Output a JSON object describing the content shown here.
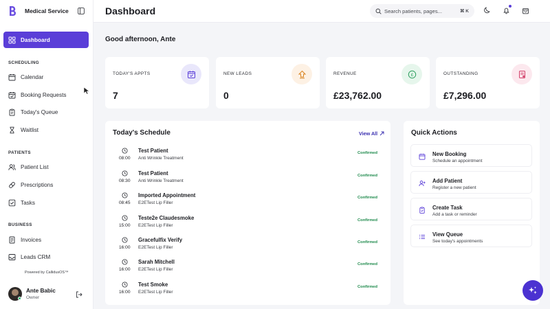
{
  "sidebar": {
    "brand_name": "Medical Service",
    "items": [
      {
        "label": "Dashboard",
        "icon": "dashboard-icon",
        "active": true
      },
      {
        "label": "Calendar",
        "icon": "calendar-icon"
      },
      {
        "label": "Booking Requests",
        "icon": "calendar-check-icon"
      },
      {
        "label": "Today's Queue",
        "icon": "clipboard-icon"
      },
      {
        "label": "Waitlist",
        "icon": "hourglass-icon"
      },
      {
        "label": "Patient List",
        "icon": "users-icon"
      },
      {
        "label": "Prescriptions",
        "icon": "pill-icon"
      },
      {
        "label": "Tasks",
        "icon": "checkbox-icon"
      },
      {
        "label": "Invoices",
        "icon": "invoice-icon"
      },
      {
        "label": "Leads CRM",
        "icon": "inbox-icon"
      }
    ],
    "sections": {
      "scheduling": "SCHEDULING",
      "patients": "PATIENTS",
      "business": "BUSINESS"
    },
    "powered_by": "Powered by CallidusOS™",
    "user": {
      "name": "Ante Babic",
      "role": "Owner"
    }
  },
  "header": {
    "title": "Dashboard",
    "search_placeholder": "Search patients, pages...",
    "search_shortcut": "⌘ K"
  },
  "main": {
    "greeting": "Good afternoon, Ante",
    "stats": [
      {
        "label": "TODAY'S APPTS",
        "value": "7",
        "icon": "calendar-check-icon",
        "color": "#e9e7fb"
      },
      {
        "label": "NEW LEADS",
        "value": "0",
        "icon": "upload-icon",
        "color": "#fdf1e4"
      },
      {
        "label": "REVENUE",
        "value": "£23,762.00",
        "icon": "pound-coin-icon",
        "color": "#e6f6ec"
      },
      {
        "label": "OUTSTANDING",
        "value": "£7,296.00",
        "icon": "receipt-icon",
        "color": "#fce8ee"
      }
    ],
    "schedule": {
      "title": "Today's Schedule",
      "view_all": "View All",
      "rows": [
        {
          "time": "08:00",
          "name": "Test Patient",
          "treatment": "Anti Wrinkle Treatment",
          "status": "Confirmed"
        },
        {
          "time": "08:30",
          "name": "Test Patient",
          "treatment": "Anti Wrinkle Treatment",
          "status": "Confirmed"
        },
        {
          "time": "08:45",
          "name": "Imported Appointment",
          "treatment": "E2ETest Lip Filler",
          "status": "Confirmed"
        },
        {
          "time": "15:00",
          "name": "Teste2e Claudesmoke",
          "treatment": "E2ETest Lip Filler",
          "status": "Confirmed"
        },
        {
          "time": "16:00",
          "name": "Gracefulfix Verify",
          "treatment": "E2ETest Lip Filler",
          "status": "Confirmed"
        },
        {
          "time": "16:00",
          "name": "Sarah Mitchell",
          "treatment": "E2ETest Lip Filler",
          "status": "Confirmed"
        },
        {
          "time": "16:00",
          "name": "Test Smoke",
          "treatment": "E2ETest Lip Filler",
          "status": "Confirmed"
        }
      ]
    },
    "quick_actions": {
      "title": "Quick Actions",
      "items": [
        {
          "title": "New Booking",
          "subtitle": "Schedule an appointment",
          "icon": "calendar-icon"
        },
        {
          "title": "Add Patient",
          "subtitle": "Register a new patient",
          "icon": "user-plus-icon"
        },
        {
          "title": "Create Task",
          "subtitle": "Add a task or reminder",
          "icon": "clipboard-icon"
        },
        {
          "title": "View Queue",
          "subtitle": "See today's appointments",
          "icon": "list-icon"
        }
      ]
    }
  },
  "colors": {
    "accent": "#5a3ed8",
    "confirmed": "#1e8a4c",
    "link": "#3a2fb0"
  }
}
